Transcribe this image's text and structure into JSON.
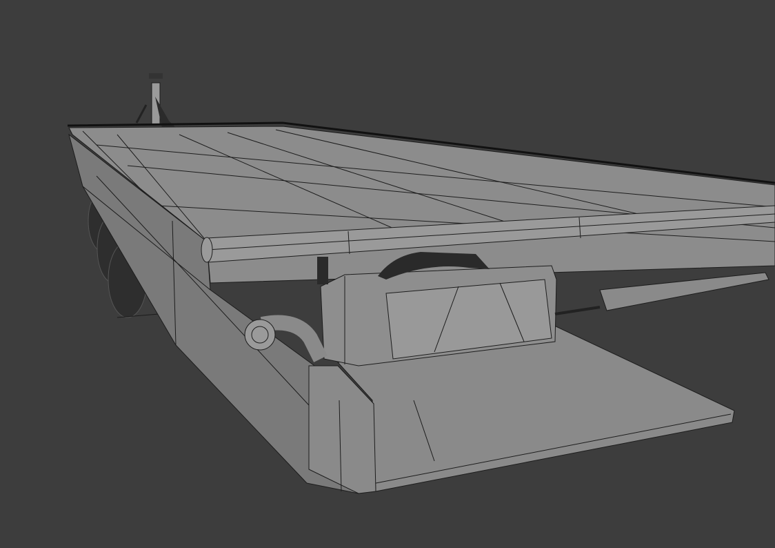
{
  "viewport": {
    "background_color": "#3d3d3d",
    "surface_color": "#8c8c8c",
    "side_color": "#7a7a7a",
    "wire_color": "#1c1c1c",
    "dark_part_color": "#2a2a2a"
  }
}
